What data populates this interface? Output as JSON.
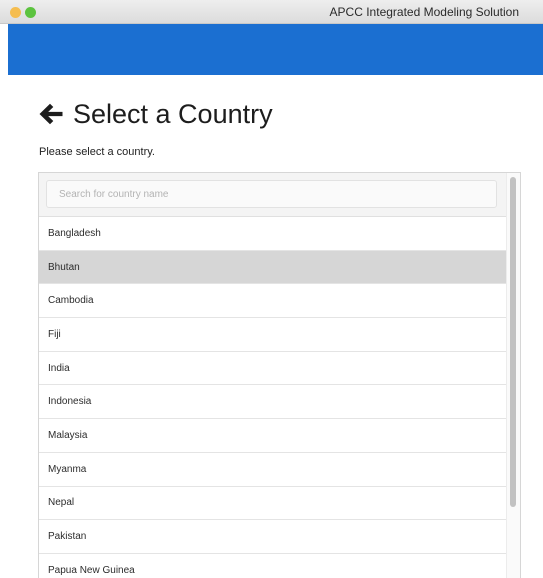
{
  "window": {
    "title": "APCC Integrated Modeling Solution"
  },
  "colors": {
    "appbar": "#1b6fd1",
    "selected_row": "#d6d6d6",
    "traffic_light_yellow": "#f5bd4f",
    "traffic_light_green": "#5cc33f"
  },
  "page": {
    "back_icon": "arrow-left-icon",
    "title": "Select a Country",
    "subtitle": "Please select a country."
  },
  "search": {
    "placeholder": "Search for country name",
    "value": ""
  },
  "countries": {
    "selected": "Bhutan",
    "items": [
      "Bangladesh",
      "Bhutan",
      "Cambodia",
      "Fiji",
      "India",
      "Indonesia",
      "Malaysia",
      "Myanma",
      "Nepal",
      "Pakistan",
      "Papua New Guinea"
    ]
  }
}
